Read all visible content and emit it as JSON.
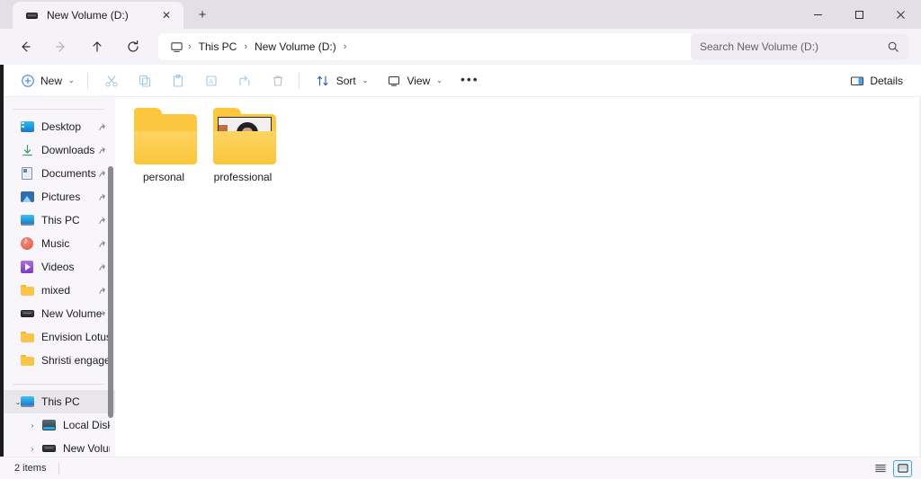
{
  "window": {
    "title": "New Volume (D:)",
    "controls": {
      "minimize": "minimize-button",
      "maximize": "maximize-button",
      "close": "close-button"
    }
  },
  "tabs": {
    "items": [
      {
        "label": "New Volume (D:)",
        "icon": "drive-icon",
        "active": true
      }
    ],
    "close_label": "✕",
    "new_tab_label": "+"
  },
  "navigation": {
    "back": "←",
    "forward": "→",
    "up": "↑",
    "refresh": "⟳",
    "breadcrumb": {
      "root_icon": "this-pc-icon",
      "separator": "›",
      "items": [
        "This PC",
        "New Volume (D:)"
      ]
    }
  },
  "search": {
    "placeholder": "Search New Volume (D:)",
    "value": "",
    "icon": "search-icon"
  },
  "toolbar": {
    "new_label": "New",
    "sort_label": "Sort",
    "view_label": "View",
    "overflow_label": "•••",
    "details_label": "Details",
    "caret": "⌄",
    "actions": [
      {
        "name": "cut",
        "icon": "scissors-icon"
      },
      {
        "name": "copy",
        "icon": "copy-icon"
      },
      {
        "name": "paste",
        "icon": "paste-icon"
      },
      {
        "name": "rename",
        "icon": "rename-icon"
      },
      {
        "name": "share",
        "icon": "share-icon"
      },
      {
        "name": "delete",
        "icon": "trash-icon"
      }
    ]
  },
  "sidebar": {
    "quick_access": [
      {
        "label": "Desktop",
        "icon": "desktop-icon",
        "pinned": true
      },
      {
        "label": "Downloads",
        "icon": "downloads-icon",
        "pinned": true
      },
      {
        "label": "Documents",
        "icon": "documents-icon",
        "pinned": true
      },
      {
        "label": "Pictures",
        "icon": "pictures-icon",
        "pinned": true
      },
      {
        "label": "This PC",
        "icon": "this-pc-icon",
        "pinned": true
      },
      {
        "label": "Music",
        "icon": "music-icon",
        "pinned": true
      },
      {
        "label": "Videos",
        "icon": "videos-icon",
        "pinned": true
      },
      {
        "label": "mixed",
        "icon": "folder-icon",
        "pinned": true
      },
      {
        "label": "New Volume",
        "icon": "drive-icon",
        "pinned": true
      },
      {
        "label": "Envision Lotus E",
        "icon": "folder-icon",
        "pinned": false
      },
      {
        "label": "Shristi engagem",
        "icon": "folder-icon",
        "pinned": false
      }
    ],
    "tree": [
      {
        "label": "This PC",
        "icon": "this-pc-icon",
        "level": 0,
        "expanded": true,
        "selected": true,
        "chevron": "⌄"
      },
      {
        "label": "Local Disk (C:)",
        "icon": "hard-disk-icon",
        "level": 1,
        "expanded": false,
        "selected": false,
        "chevron": "›"
      },
      {
        "label": "New Volume (D",
        "icon": "drive-icon",
        "level": 1,
        "expanded": false,
        "selected": false,
        "chevron": "›"
      }
    ],
    "pin_glyph": "📌"
  },
  "files": {
    "items": [
      {
        "name": "personal",
        "type": "folder",
        "has_preview": false
      },
      {
        "name": "professional",
        "type": "folder",
        "has_preview": true
      }
    ]
  },
  "status": {
    "item_count": "2 items",
    "view_list_icon": "details-view-icon",
    "view_icons_icon": "large-icons-view-icon",
    "active_view": "large-icons-view-icon"
  },
  "colors": {
    "titlebar": "#e3dfe9",
    "addressbar": "#f5f2f8",
    "sidebar": "#f8f6fa",
    "content": "#ffffff",
    "accent": "#4aa3e0",
    "folder": "#fcc73f"
  }
}
